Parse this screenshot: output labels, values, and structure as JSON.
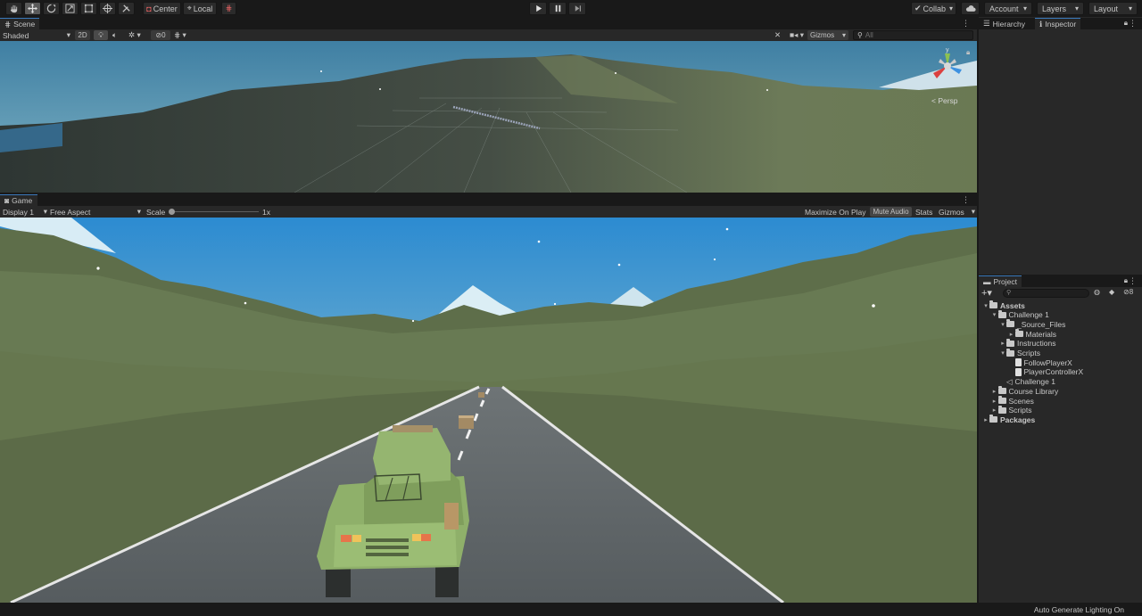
{
  "toolbar": {
    "pivot_label": "Center",
    "space_label": "Local",
    "collab_label": "Collab",
    "account_label": "Account",
    "layers_label": "Layers",
    "layout_label": "Layout"
  },
  "scene": {
    "tab_label": "Scene",
    "shading_mode": "Shaded",
    "mode_2d_label": "2D",
    "hidden_count": "0",
    "gizmos_label": "Gizmos",
    "search_placeholder": "All",
    "persp_label": "Persp",
    "axis_y_label": "y"
  },
  "game": {
    "tab_label": "Game",
    "display_label": "Display 1",
    "aspect_label": "Free Aspect",
    "scale_label": "Scale",
    "scale_value": "1x",
    "maximize_label": "Maximize On Play",
    "mute_label": "Mute Audio",
    "stats_label": "Stats",
    "gizmos_label": "Gizmos"
  },
  "right_tabs": {
    "hierarchy_label": "Hierarchy",
    "inspector_label": "Inspector"
  },
  "project": {
    "tab_label": "Project",
    "hidden_count": "8",
    "tree": [
      {
        "label": "Assets",
        "depth": 0,
        "kind": "folder-open",
        "bold": true
      },
      {
        "label": "Challenge 1",
        "depth": 1,
        "kind": "folder-open",
        "bold": false
      },
      {
        "label": "_Source_Files",
        "depth": 2,
        "kind": "folder-open",
        "bold": false
      },
      {
        "label": "Materials",
        "depth": 3,
        "kind": "folder-closed",
        "bold": false
      },
      {
        "label": "Instructions",
        "depth": 2,
        "kind": "folder-closed",
        "bold": false
      },
      {
        "label": "Scripts",
        "depth": 2,
        "kind": "folder-open",
        "bold": false
      },
      {
        "label": "FollowPlayerX",
        "depth": 3,
        "kind": "script",
        "bold": false
      },
      {
        "label": "PlayerControllerX",
        "depth": 3,
        "kind": "script",
        "bold": false
      },
      {
        "label": "Challenge 1",
        "depth": 2,
        "kind": "scene",
        "bold": false
      },
      {
        "label": "Course Library",
        "depth": 1,
        "kind": "folder-closed",
        "bold": false
      },
      {
        "label": "Scenes",
        "depth": 1,
        "kind": "folder-closed",
        "bold": false
      },
      {
        "label": "Scripts",
        "depth": 1,
        "kind": "folder-closed",
        "bold": false
      },
      {
        "label": "Packages",
        "depth": 0,
        "kind": "folder-closed",
        "bold": true
      }
    ]
  },
  "status": {
    "lighting_label": "Auto Generate Lighting On"
  },
  "colors": {
    "accent": "#3a79bb",
    "panel": "#282828",
    "background": "#191919",
    "sky_top": "#2f8ed0",
    "sky_bottom": "#a3c7cf",
    "hills": "#66774f",
    "road": "#5d6366",
    "vehicle": "#8fb06a"
  }
}
